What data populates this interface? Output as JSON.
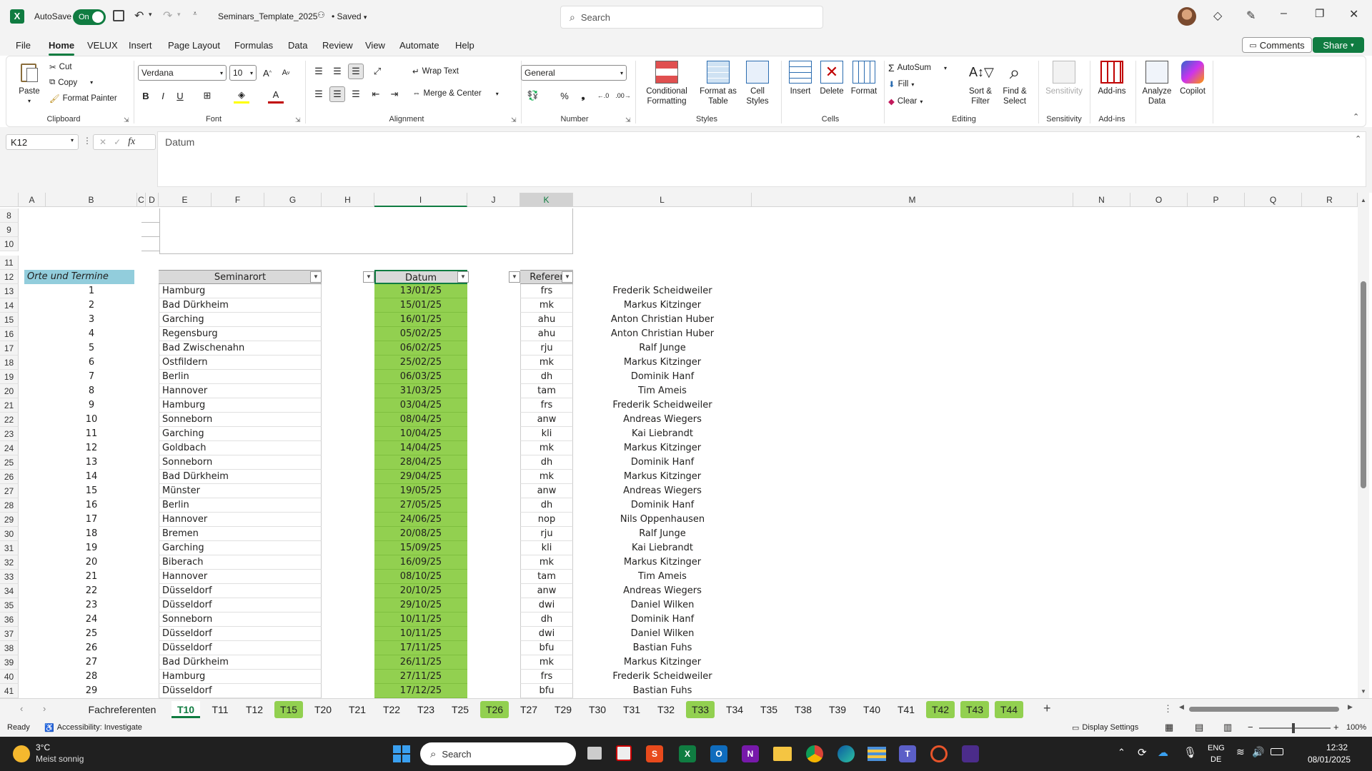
{
  "titlebar": {
    "autosave_label": "AutoSave",
    "autosave_state": "On",
    "filename": "Seminars_Template_2025",
    "saved_status": "• Saved",
    "search_placeholder": "Search"
  },
  "menu": {
    "items": [
      "File",
      "Home",
      "VELUX",
      "Insert",
      "Page Layout",
      "Formulas",
      "Data",
      "Review",
      "View",
      "Automate",
      "Help"
    ],
    "active": "Home",
    "comments_label": "Comments",
    "share_label": "Share"
  },
  "ribbon": {
    "clipboard": {
      "paste": "Paste",
      "cut": "Cut",
      "copy": "Copy",
      "format_painter": "Format Painter",
      "label": "Clipboard"
    },
    "font": {
      "name": "Verdana",
      "size": "10",
      "label": "Font"
    },
    "alignment": {
      "wrap_text": "Wrap Text",
      "merge_center": "Merge & Center",
      "label": "Alignment"
    },
    "number": {
      "format": "General",
      "label": "Number"
    },
    "styles": {
      "conditional": "Conditional Formatting",
      "format_table": "Format as Table",
      "cell_styles": "Cell Styles",
      "label": "Styles"
    },
    "cells": {
      "insert": "Insert",
      "delete": "Delete",
      "format": "Format",
      "label": "Cells"
    },
    "editing": {
      "autosum": "AutoSum",
      "fill": "Fill",
      "clear": "Clear",
      "sort_filter": "Sort & Filter",
      "find_select": "Find & Select",
      "label": "Editing"
    },
    "sensitivity": {
      "button": "Sensitivity",
      "label": "Sensitivity"
    },
    "addins": {
      "button": "Add-ins",
      "label": "Add-ins"
    },
    "analyze": "Analyze Data",
    "copilot": "Copilot"
  },
  "formula_bar": {
    "name_box": "K12",
    "fx": "fx",
    "content": "Datum"
  },
  "columns": [
    "A",
    "B",
    "C",
    "D",
    "E",
    "F",
    "G",
    "H",
    "I",
    "J",
    "K",
    "L",
    "M",
    "N",
    "O",
    "P",
    "Q",
    "R"
  ],
  "header_row": {
    "row": "12",
    "orte": "Orte und Termine",
    "seminarort": "Seminarort",
    "datum": "Datum",
    "referent": "Referer"
  },
  "empty_rows": [
    "8",
    "9",
    "10",
    "11"
  ],
  "rows": [
    {
      "r": "13",
      "n": "1",
      "ort": "Hamburg",
      "datum": "13/01/25",
      "kz": "frs",
      "name": "Frederik Scheidweiler"
    },
    {
      "r": "14",
      "n": "2",
      "ort": "Bad Dürkheim",
      "datum": "15/01/25",
      "kz": "mk",
      "name": "Markus Kitzinger"
    },
    {
      "r": "15",
      "n": "3",
      "ort": "Garching",
      "datum": "16/01/25",
      "kz": "ahu",
      "name": "Anton Christian Huber"
    },
    {
      "r": "16",
      "n": "4",
      "ort": "Regensburg",
      "datum": "05/02/25",
      "kz": "ahu",
      "name": "Anton Christian Huber"
    },
    {
      "r": "17",
      "n": "5",
      "ort": "Bad Zwischenahn",
      "datum": "06/02/25",
      "kz": "rju",
      "name": "Ralf Junge"
    },
    {
      "r": "18",
      "n": "6",
      "ort": "Ostfildern",
      "datum": "25/02/25",
      "kz": "mk",
      "name": "Markus Kitzinger"
    },
    {
      "r": "19",
      "n": "7",
      "ort": "Berlin",
      "datum": "06/03/25",
      "kz": "dh",
      "name": "Dominik Hanf"
    },
    {
      "r": "20",
      "n": "8",
      "ort": "Hannover",
      "datum": "31/03/25",
      "kz": "tam",
      "name": "Tim Ameis"
    },
    {
      "r": "21",
      "n": "9",
      "ort": "Hamburg",
      "datum": "03/04/25",
      "kz": "frs",
      "name": "Frederik Scheidweiler"
    },
    {
      "r": "22",
      "n": "10",
      "ort": "Sonneborn",
      "datum": "08/04/25",
      "kz": "anw",
      "name": "Andreas Wiegers"
    },
    {
      "r": "23",
      "n": "11",
      "ort": "Garching",
      "datum": "10/04/25",
      "kz": "kli",
      "name": "Kai Liebrandt"
    },
    {
      "r": "24",
      "n": "12",
      "ort": "Goldbach",
      "datum": "14/04/25",
      "kz": "mk",
      "name": "Markus Kitzinger"
    },
    {
      "r": "25",
      "n": "13",
      "ort": "Sonneborn",
      "datum": "28/04/25",
      "kz": "dh",
      "name": "Dominik Hanf"
    },
    {
      "r": "26",
      "n": "14",
      "ort": "Bad Dürkheim",
      "datum": "29/04/25",
      "kz": "mk",
      "name": "Markus Kitzinger"
    },
    {
      "r": "27",
      "n": "15",
      "ort": "Münster",
      "datum": "19/05/25",
      "kz": "anw",
      "name": "Andreas Wiegers"
    },
    {
      "r": "28",
      "n": "16",
      "ort": "Berlin",
      "datum": "27/05/25",
      "kz": "dh",
      "name": "Dominik Hanf"
    },
    {
      "r": "29",
      "n": "17",
      "ort": "Hannover",
      "datum": "24/06/25",
      "kz": "nop",
      "name": "Nils Oppenhausen"
    },
    {
      "r": "30",
      "n": "18",
      "ort": "Bremen",
      "datum": "20/08/25",
      "kz": "rju",
      "name": "Ralf Junge"
    },
    {
      "r": "31",
      "n": "19",
      "ort": "Garching",
      "datum": "15/09/25",
      "kz": "kli",
      "name": "Kai Liebrandt"
    },
    {
      "r": "32",
      "n": "20",
      "ort": "Biberach",
      "datum": "16/09/25",
      "kz": "mk",
      "name": "Markus Kitzinger"
    },
    {
      "r": "33",
      "n": "21",
      "ort": "Hannover",
      "datum": "08/10/25",
      "kz": "tam",
      "name": "Tim Ameis"
    },
    {
      "r": "34",
      "n": "22",
      "ort": "Düsseldorf",
      "datum": "20/10/25",
      "kz": "anw",
      "name": "Andreas Wiegers"
    },
    {
      "r": "35",
      "n": "23",
      "ort": "Düsseldorf",
      "datum": "29/10/25",
      "kz": "dwi",
      "name": "Daniel Wilken"
    },
    {
      "r": "36",
      "n": "24",
      "ort": "Sonneborn",
      "datum": "10/11/25",
      "kz": "dh",
      "name": "Dominik Hanf"
    },
    {
      "r": "37",
      "n": "25",
      "ort": "Düsseldorf",
      "datum": "10/11/25",
      "kz": "dwi",
      "name": "Daniel Wilken"
    },
    {
      "r": "38",
      "n": "26",
      "ort": "Düsseldorf",
      "datum": "17/11/25",
      "kz": "bfu",
      "name": "Bastian Fuhs"
    },
    {
      "r": "39",
      "n": "27",
      "ort": "Bad Dürkheim",
      "datum": "26/11/25",
      "kz": "mk",
      "name": "Markus Kitzinger"
    },
    {
      "r": "40",
      "n": "28",
      "ort": "Hamburg",
      "datum": "27/11/25",
      "kz": "frs",
      "name": "Frederik Scheidweiler"
    },
    {
      "r": "41",
      "n": "29",
      "ort": "Düsseldorf",
      "datum": "17/12/25",
      "kz": "bfu",
      "name": "Bastian Fuhs"
    }
  ],
  "sheet_tabs": [
    {
      "label": "Fachreferenten",
      "style": "plain"
    },
    {
      "label": "T10",
      "style": "active"
    },
    {
      "label": "T11",
      "style": "plain"
    },
    {
      "label": "T12",
      "style": "plain"
    },
    {
      "label": "T15",
      "style": "green"
    },
    {
      "label": "T20",
      "style": "plain"
    },
    {
      "label": "T21",
      "style": "plain"
    },
    {
      "label": "T22",
      "style": "plain"
    },
    {
      "label": "T23",
      "style": "plain"
    },
    {
      "label": "T25",
      "style": "plain"
    },
    {
      "label": "T26",
      "style": "green"
    },
    {
      "label": "T27",
      "style": "plain"
    },
    {
      "label": "T29",
      "style": "plain"
    },
    {
      "label": "T30",
      "style": "plain"
    },
    {
      "label": "T31",
      "style": "plain"
    },
    {
      "label": "T32",
      "style": "plain"
    },
    {
      "label": "T33",
      "style": "green"
    },
    {
      "label": "T34",
      "style": "plain"
    },
    {
      "label": "T35",
      "style": "plain"
    },
    {
      "label": "T38",
      "style": "plain"
    },
    {
      "label": "T39",
      "style": "plain"
    },
    {
      "label": "T40",
      "style": "plain"
    },
    {
      "label": "T41",
      "style": "plain"
    },
    {
      "label": "T42",
      "style": "green"
    },
    {
      "label": "T43",
      "style": "green"
    },
    {
      "label": "T44",
      "style": "green"
    }
  ],
  "status": {
    "ready": "Ready",
    "accessibility": "Accessibility: Investigate",
    "display_settings": "Display Settings",
    "zoom": "100%"
  },
  "taskbar": {
    "weather_temp": "3°C",
    "weather_desc": "Meist sonnig",
    "search": "Search",
    "lang1": "ENG",
    "lang2": "DE",
    "time": "12:32",
    "date": "08/01/2025"
  },
  "colors": {
    "excel_green": "#107c41",
    "date_fill": "#92d050",
    "header_fill": "#92cddc",
    "taskbar": "#202020"
  }
}
